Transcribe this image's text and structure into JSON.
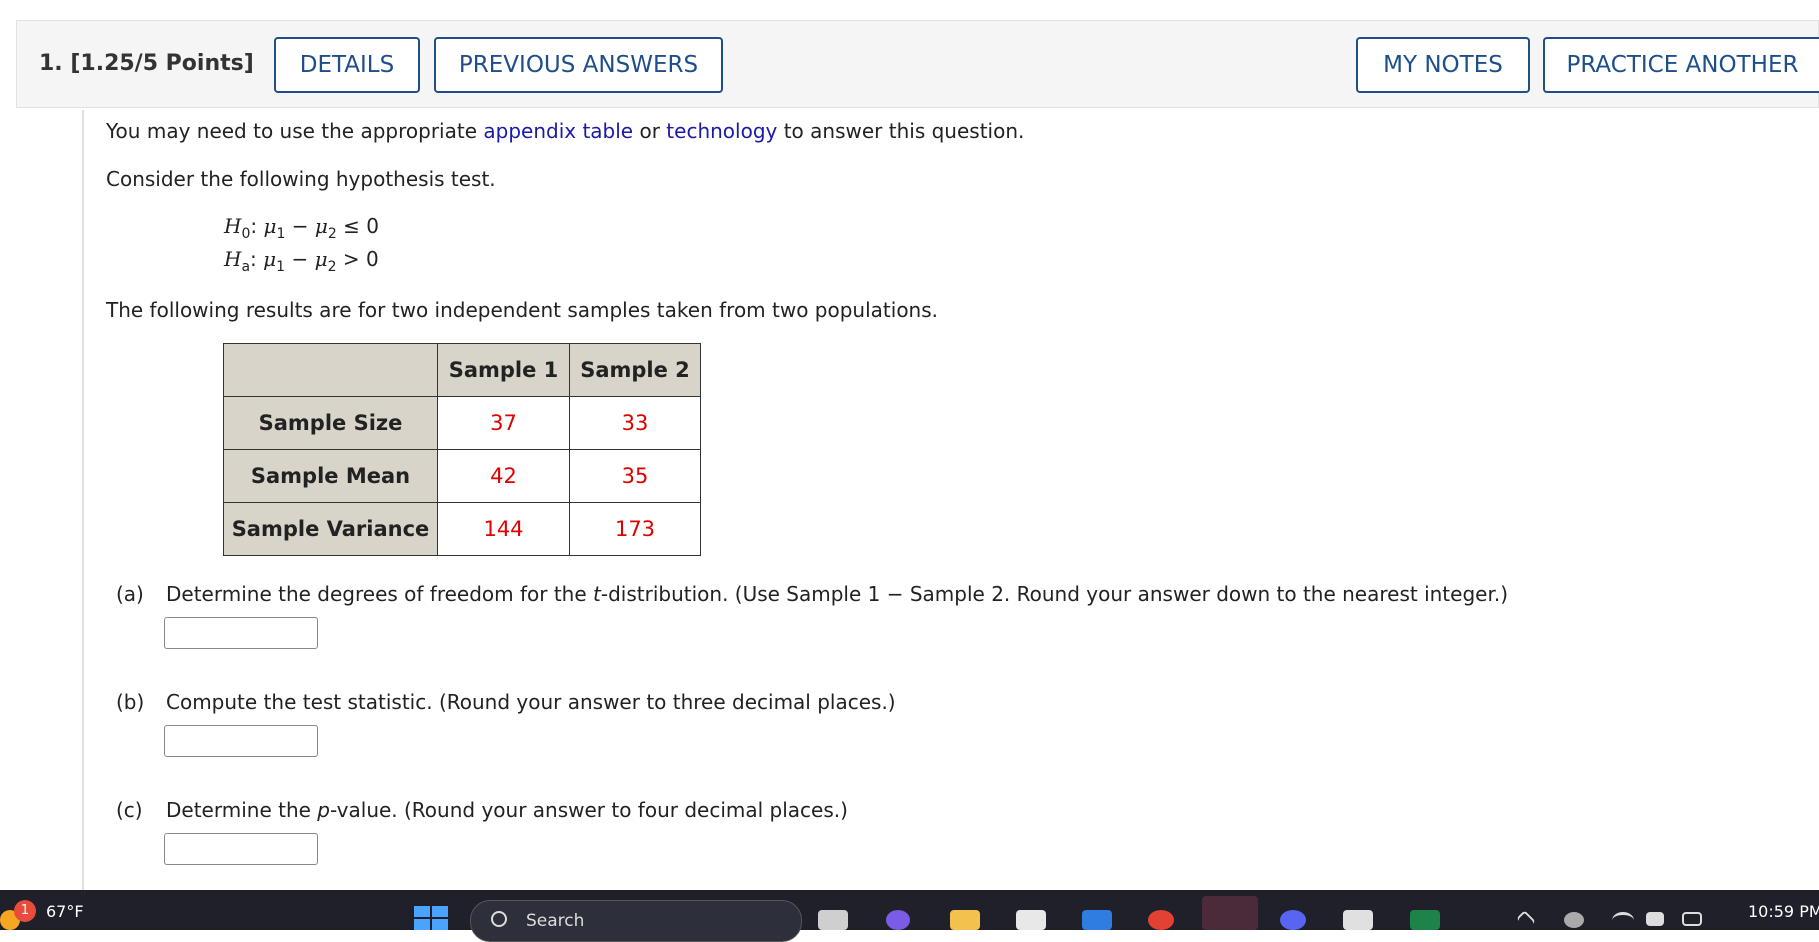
{
  "question": {
    "number_label": "1.",
    "points_label": "[1.25/5 Points]",
    "buttons": {
      "details": "DETAILS",
      "previous_answers": "PREVIOUS ANSWERS",
      "my_notes": "MY NOTES",
      "practice_another": "PRACTICE ANOTHER"
    }
  },
  "body": {
    "intro_pre": "You may need to use the appropriate ",
    "intro_link1": "appendix table",
    "intro_mid": " or ",
    "intro_link2": "technology",
    "intro_post": " to answer this question.",
    "consider": "Consider the following hypothesis test.",
    "h0": {
      "H": "H",
      "sub": "0",
      "rel": "≤ 0"
    },
    "ha": {
      "H": "H",
      "sub": "a",
      "rel": "> 0"
    },
    "mu": "μ",
    "minus": "−",
    "results": "The following results are for two independent samples taken from two populations."
  },
  "table": {
    "headers": [
      "",
      "Sample 1",
      "Sample 2"
    ],
    "rows": [
      {
        "label": "Sample Size",
        "s1": "37",
        "s2": "33"
      },
      {
        "label": "Sample Mean",
        "s1": "42",
        "s2": "35"
      },
      {
        "label": "Sample Variance",
        "s1": "144",
        "s2": "173"
      }
    ]
  },
  "parts": {
    "a": {
      "label": "(a)",
      "pre": "Determine the degrees of freedom for the ",
      "ital": "t",
      "post": "-distribution. (Use Sample 1 − Sample 2. Round your answer down to the nearest integer.)"
    },
    "b": {
      "label": "(b)",
      "text": "Compute the test statistic. (Round your answer to three decimal places.)"
    },
    "c": {
      "label": "(c)",
      "pre": "Determine the ",
      "ital": "p",
      "post": "-value. (Round your answer to four decimal places.)"
    }
  },
  "taskbar": {
    "weather_badge": "1",
    "temperature": "67°F",
    "search_text": "Search",
    "clock": "10:59 PM"
  },
  "colors": {
    "link": "#1a1aa6",
    "button_border": "#1e4f8a",
    "value_red": "#e00000",
    "table_header_bg": "#d8d4ca"
  }
}
